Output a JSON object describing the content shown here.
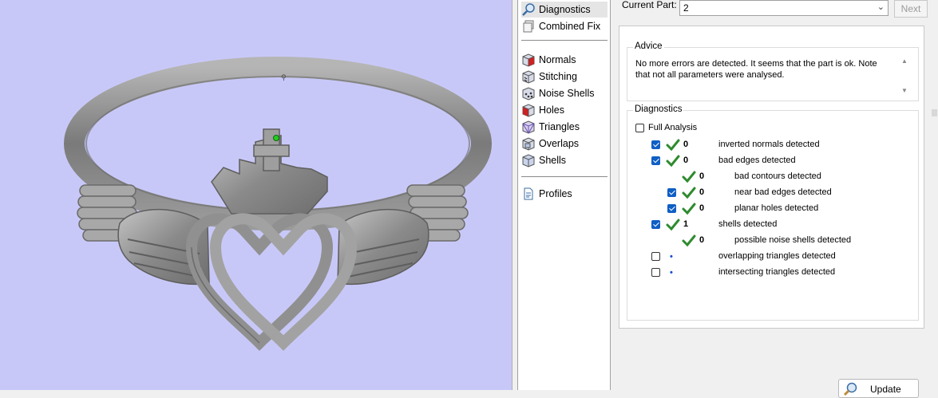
{
  "nav": {
    "items": [
      {
        "label": "Diagnostics",
        "icon": "magnifier-icon"
      },
      {
        "label": "Combined Fix",
        "icon": "cube-stack-icon"
      },
      {
        "label": "Normals",
        "icon": "cube-normals-icon"
      },
      {
        "label": "Stitching",
        "icon": "cube-stitching-icon"
      },
      {
        "label": "Noise Shells",
        "icon": "cube-noise-shells-icon"
      },
      {
        "label": "Holes",
        "icon": "cube-holes-icon"
      },
      {
        "label": "Triangles",
        "icon": "cube-triangles-icon"
      },
      {
        "label": "Overlaps",
        "icon": "cube-overlaps-icon"
      },
      {
        "label": "Shells",
        "icon": "cube-shells-icon"
      },
      {
        "label": "Profiles",
        "icon": "document-icon"
      }
    ],
    "selected": "Diagnostics"
  },
  "part": {
    "label": "Current Part:",
    "value": "2",
    "next_label": "Next"
  },
  "advice": {
    "title": "Advice",
    "text": "No more errors are detected. It seems that the part is ok. Note that not all parameters were analysed."
  },
  "diagnostics": {
    "title": "Diagnostics",
    "full_analysis_label": "Full Analysis",
    "full_analysis_checked": false,
    "rows": [
      {
        "checked": true,
        "status": "ok",
        "count": "0",
        "text": "inverted normals detected"
      },
      {
        "checked": true,
        "status": "ok",
        "count": "0",
        "text": "bad edges detected"
      },
      {
        "checked": null,
        "status": "ok",
        "count": "0",
        "text": "bad contours detected"
      },
      {
        "checked": true,
        "status": "ok",
        "count": "0",
        "text": "near bad edges detected"
      },
      {
        "checked": true,
        "status": "ok",
        "count": "0",
        "text": "planar holes detected"
      },
      {
        "checked": true,
        "status": "ok",
        "count": "1",
        "text": "shells detected"
      },
      {
        "checked": null,
        "status": "ok",
        "count": "0",
        "text": "possible noise shells detected"
      },
      {
        "checked": false,
        "status": "pending",
        "count": "",
        "text": "overlapping triangles detected"
      },
      {
        "checked": false,
        "status": "pending",
        "count": "",
        "text": "intersecting triangles detected"
      }
    ],
    "update_label": "Update"
  },
  "colors": {
    "viewport_bg": "#c8c8f8",
    "model": "#8c8c8c",
    "check_accent": "#0f5fc4",
    "ok_tick": "#2e8b2e"
  }
}
